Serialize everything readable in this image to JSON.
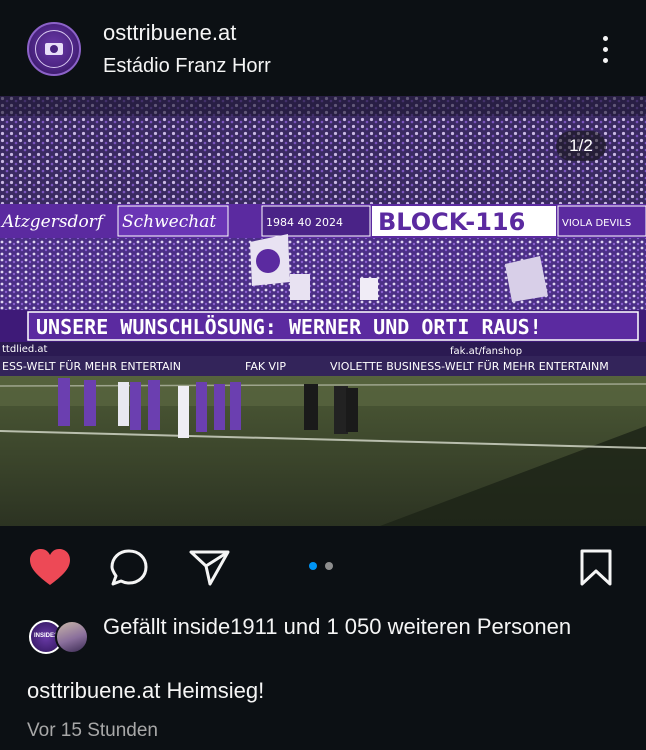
{
  "header": {
    "username": "osttribuene.at",
    "location": "Estádio Franz Horr",
    "avatar_icon": "club-logo-icon",
    "more_icon": "more-options-icon"
  },
  "photo": {
    "counter": "1/2",
    "banners": {
      "top_left": "Atzgersdorf",
      "top_mid": "Schwechat",
      "top_years": "1984 40 2024",
      "top_block": "BLOCK-116",
      "top_right": "VIOLA DEVILS",
      "main": "UNSERE WUNSCHLÖSUNG: WERNER UND ORTI RAUS!",
      "ad_left": "ESS-WELT FÜR MEHR ENTERTAIN",
      "ad_mid": "FAK VIP",
      "ad_right": "VIOLETTE BUSINESS-WELT FÜR MEHR ENTERTAINM",
      "ad_small_left": "ttdlied.at",
      "ad_small_right": "fak.at/fanshop"
    },
    "colors": {
      "violet": "#5b2aa0",
      "pitch": "#3d4a2c"
    }
  },
  "actions": {
    "like_icon": "heart-icon",
    "comment_icon": "comment-icon",
    "share_icon": "send-icon",
    "save_icon": "bookmark-icon",
    "liked": true,
    "like_color": "#ed4956",
    "active_dot_color": "#0095f6",
    "slides": 2,
    "active_slide": 1
  },
  "likes": {
    "prefix": "Gefällt ",
    "user": "inside1911",
    "middle": " und ",
    "count": "1 050 weiteren Personen",
    "avatar1_text": "INSIDE1911"
  },
  "caption": {
    "username": "osttribuene.at",
    "text": "Heimsieg!"
  },
  "time": "Vor 15 Stunden"
}
